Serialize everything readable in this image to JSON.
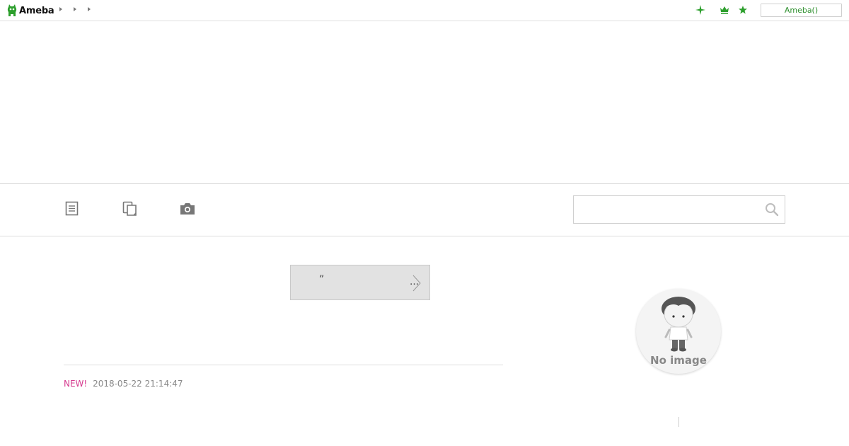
{
  "header": {
    "logo_text": "Ameba",
    "login_label": "Ameba()",
    "icons": [
      "sparkle-icon",
      "crown-icon",
      "star-icon"
    ],
    "accent_color": "#2d9f2d"
  },
  "toolbar": {
    "icons": [
      "article-list-icon",
      "copy-pages-icon",
      "camera-icon"
    ],
    "search": {
      "placeholder": "",
      "icon": "search-icon"
    }
  },
  "main": {
    "notice": {
      "quote": "”",
      "ellipsis": "…"
    },
    "entry": {
      "new_label": "NEW!",
      "timestamp": "2018-05-22 21:14:47"
    }
  },
  "sidebar": {
    "avatar_text": "No image"
  },
  "colors": {
    "new_badge": "#d63b8f",
    "timestamp": "#888888",
    "border": "#dcdcdc"
  }
}
